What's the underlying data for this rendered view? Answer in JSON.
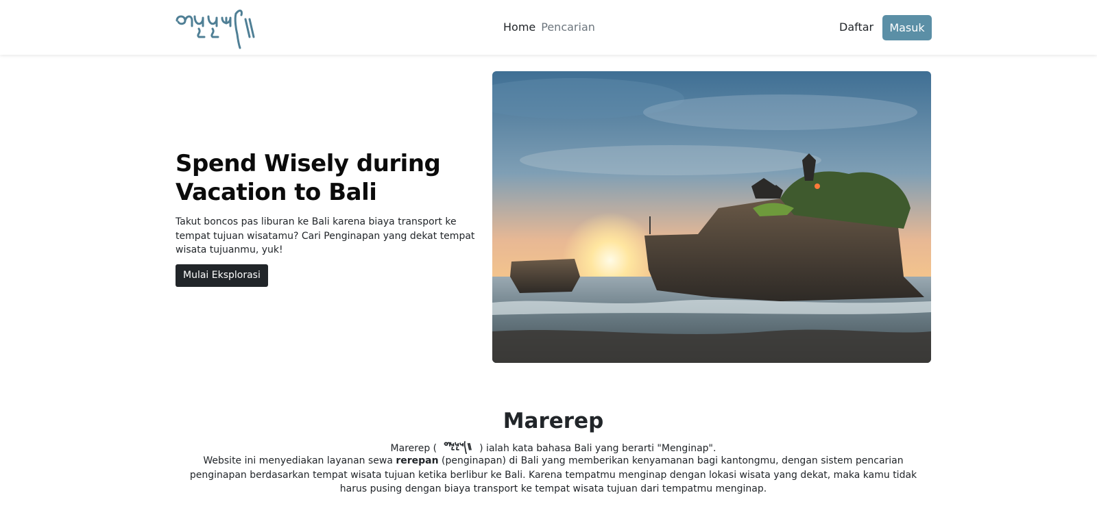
{
  "navbar": {
    "logo_icon": "balinese-script-logo",
    "links": [
      {
        "label": "Home",
        "active": true
      },
      {
        "label": "Pencarian",
        "active": false
      }
    ],
    "register_label": "Daftar",
    "login_label": "Masuk",
    "login_color": "#5b8fa6"
  },
  "hero": {
    "title_line1": "Spend Wisely during",
    "title_line2": "Vacation to Bali",
    "description": "Takut boncos pas liburan ke Bali karena biaya transport ke tempat tujuan wisatamu? Cari Penginapan yang dekat tempat wisata tujuanmu, yuk!",
    "cta_label": "Mulai Eksplorasi",
    "image": "tanah-lot-temple-sunset-photo"
  },
  "about": {
    "title": "Marerep",
    "line1_prefix": "Marerep (",
    "line1_suffix": ") ialah kata bahasa Bali yang berarti \"Menginap\".",
    "para_prefix": "Website ini menyediakan layanan sewa ",
    "para_bold": "rerepan",
    "para_suffix": " (penginapan) di Bali yang memberikan kenyamanan bagi kantongmu, dengan sistem pencarian penginapan berdasarkan tempat wisata tujuan ketika berlibur ke Bali. Karena tempatmu menginap dengan lokasi wisata yang dekat, maka kamu tidak harus pusing dengan biaya transport ke tempat wisata tujuan dari tempatmu menginap."
  }
}
